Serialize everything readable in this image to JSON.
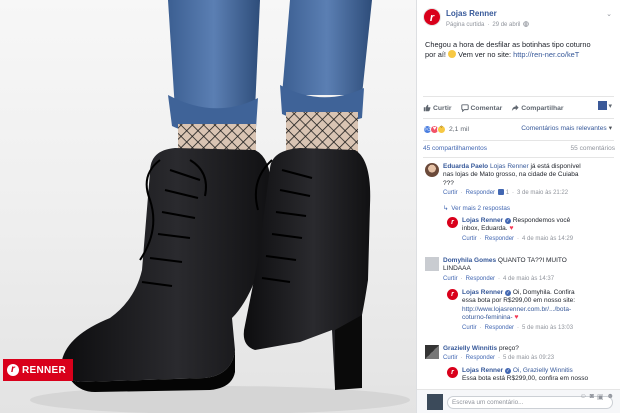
{
  "photo": {
    "brand_logo_text": "RENNER"
  },
  "post": {
    "page_name": "Lojas Renner",
    "page_category": "Página curtida",
    "date": "29 de abril",
    "text_line1": "Chegou a hora de desfilar as botinhas tipo coturno",
    "text_line2_prefix": "por aí!",
    "text_line2_mid": "Vem ver no site:",
    "link": "http://ren-ner.co/keT"
  },
  "actions": {
    "like": "Curtir",
    "comment": "Comentar",
    "share": "Compartilhar"
  },
  "reactions": {
    "count": "2,1 mil",
    "sort_label": "Comentários mais relevantes",
    "shares": "45 compartilhamentos",
    "comments": "55 comentários"
  },
  "comments": [
    {
      "author": "Eduarda Paelo",
      "text": "Lojas Renner já está disponível nas lojas de Mato grosso, na cidade de Cuiaba ???",
      "mention": "Lojas Renner",
      "rest_line1": " já está disponível",
      "line2": "nas lojas de Mato grosso, na cidade de Cuiaba",
      "line3": "???",
      "like": "Curtir",
      "reply": "Responder",
      "reply_count": "1",
      "time": "3 de maio às 21:22",
      "replies_link": "Ver mais 2 respostas",
      "reply_item": {
        "author": "Lojas Renner",
        "line1": "Respondemos você",
        "line2": "inbox, Eduarda.",
        "like": "Curtir",
        "reply": "Responder",
        "time": "4 de maio às 14:29"
      }
    },
    {
      "author": "Domyhila Gomes",
      "line1": "QUANTO TA??I MUITO",
      "line2": "LINDAAA",
      "like": "Curtir",
      "reply": "Responder",
      "time": "4 de maio às 14:37",
      "reply_item": {
        "author": "Lojas Renner",
        "line1": "Oi, Domyhila. Confira",
        "line2": "essa bota por R$299,00 em nosso site:",
        "link": "http://www.lojasrenner.com.br/.../bota-",
        "line3": "coturno-feminina-",
        "like": "Curtir",
        "reply": "Responder",
        "time": "5 de maio às 13:03"
      }
    },
    {
      "author": "Grazielly Winnitis",
      "text": "preço?",
      "like": "Curtir",
      "reply": "Responder",
      "time": "5 de maio às 09:23",
      "reply_item": {
        "author": "Lojas Renner",
        "mention": "Oi, Grazielly Winnitis",
        "line2": "Essa bota está R$299,00, confira em nosso"
      }
    }
  ],
  "composer": {
    "placeholder": "Escreva um comentário..."
  },
  "colors": {
    "brand_red": "#d9001b",
    "link_blue": "#365899",
    "action_blue": "#4267b2"
  }
}
